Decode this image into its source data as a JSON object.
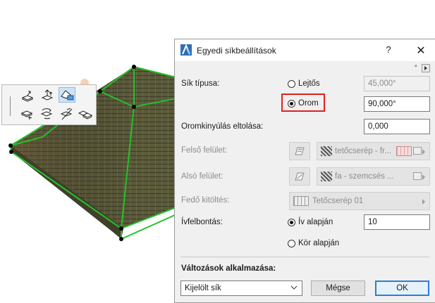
{
  "dialog": {
    "title": "Egyedi síkbeállítások",
    "help": "?",
    "close": "✕",
    "corner_mark": "°",
    "sik_tipusa": {
      "label": "Sík típusa:",
      "options": [
        {
          "label": "Lejtős",
          "selected": false,
          "value": "45,000°"
        },
        {
          "label": "Orom",
          "selected": true,
          "value": "90,000°"
        }
      ]
    },
    "oromkinyulas": {
      "label": "Oromkinyúlás eltolása:",
      "value": "0,000"
    },
    "felso_felulet": {
      "label": "Felső felület:",
      "material": "tetőcserép - fr..."
    },
    "also_felulet": {
      "label": "Alsó felület:",
      "material": "fa - szemcsés ..."
    },
    "fedo_kitoltes": {
      "label": "Fedő kitöltés:",
      "value": "Tetőcserép 01"
    },
    "ivfelbontas": {
      "label": "Ívfelbontás:",
      "options": [
        {
          "label": "Ív alapján",
          "selected": true,
          "value": "10"
        },
        {
          "label": "Kör alapján",
          "selected": false
        }
      ]
    },
    "valtozasok": {
      "label": "Változások alkalmazása:",
      "selected": "Kijelölt sík"
    },
    "cancel_label": "Mégse",
    "ok_label": "OK"
  },
  "colors": {
    "highlight": "#e02020",
    "selection_edge": "#22c22a",
    "roof": "#5a5a3a",
    "ok_border": "#2f7bd6"
  }
}
